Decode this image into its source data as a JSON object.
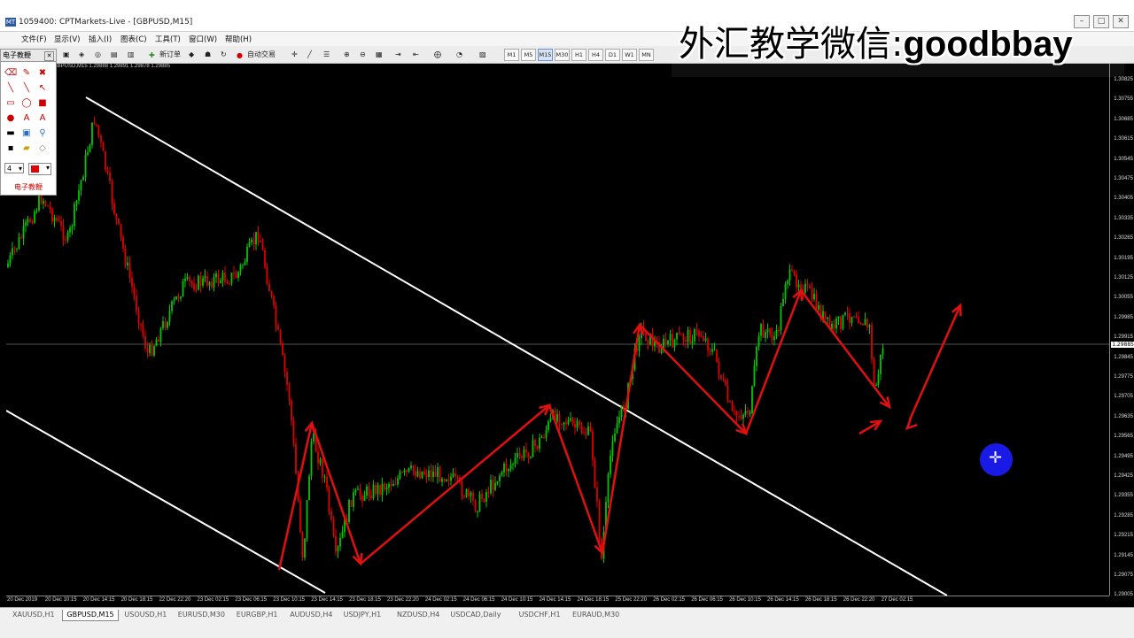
{
  "window": {
    "title": "1059400: CPTMarkets-Live - [GBPUSD,M15]",
    "app_icon": "mt4-icon",
    "controls": [
      "–",
      "□",
      "✕"
    ]
  },
  "menu": [
    "文件(F)",
    "显示(V)",
    "插入(I)",
    "图表(C)",
    "工具(T)",
    "窗口(W)",
    "帮助(H)"
  ],
  "toolbar": {
    "new_order": "新订单",
    "autotrade": "自动交易",
    "timeframes": [
      "M1",
      "M5",
      "M15",
      "M30",
      "H1",
      "H4",
      "D1",
      "W1",
      "MN"
    ],
    "active_timeframe": "M15"
  },
  "chart": {
    "ohlc": "GBPUSD,M15 1.29888 1.29891 1.29878 1.29885",
    "current_price": "1.29885",
    "price_ticks": [
      "1.30825",
      "1.30755",
      "1.30685",
      "1.30615",
      "1.30545",
      "1.30475",
      "1.30405",
      "1.30335",
      "1.30265",
      "1.30195",
      "1.30125",
      "1.30055",
      "1.29985",
      "1.29915",
      "1.29845",
      "1.29775",
      "1.29705",
      "1.29635",
      "1.29565",
      "1.29495",
      "1.29425",
      "1.29355",
      "1.29285",
      "1.29215",
      "1.29145",
      "1.29075",
      "1.29005"
    ],
    "time_ticks": [
      "20 Dec 2019",
      "20 Dec 10:15",
      "20 Dec 14:15",
      "20 Dec 18:15",
      "22 Dec 22:20",
      "23 Dec 02:15",
      "23 Dec 06:15",
      "23 Dec 10:15",
      "23 Dec 14:15",
      "23 Dec 18:15",
      "23 Dec 22:20",
      "24 Dec 02:15",
      "24 Dec 06:15",
      "24 Dec 10:15",
      "24 Dec 14:15",
      "24 Dec 18:15",
      "25 Dec 22:20",
      "26 Dec 02:15",
      "26 Dec 06:15",
      "26 Dec 10:15",
      "26 Dec 14:15",
      "26 Dec 18:15",
      "26 Dec 22:20",
      "27 Dec 02:15"
    ],
    "colors": {
      "bull": "#00c800",
      "bear": "#e00000",
      "arrows": "#e01010",
      "channel": "#ffffff"
    }
  },
  "tools_panel": {
    "title": "电子教鞭",
    "width_value": "4",
    "footer": "电子教鞭"
  },
  "watermark": {
    "cn": "外汇教学微信:",
    "en": "goodbbay"
  },
  "tabs": [
    "XAUUSD,H1",
    "GBPUSD,M15",
    "USOUSD,H1",
    "EURUSD,M30",
    "EURGBP,H1",
    "AUDUSD,H4",
    "USDJPY,H1",
    "NZDUSD,H4",
    "USDCAD,Daily",
    "USDCHF,H1",
    "EURAUD,M30"
  ],
  "active_tab": "GBPUSD,M15"
}
